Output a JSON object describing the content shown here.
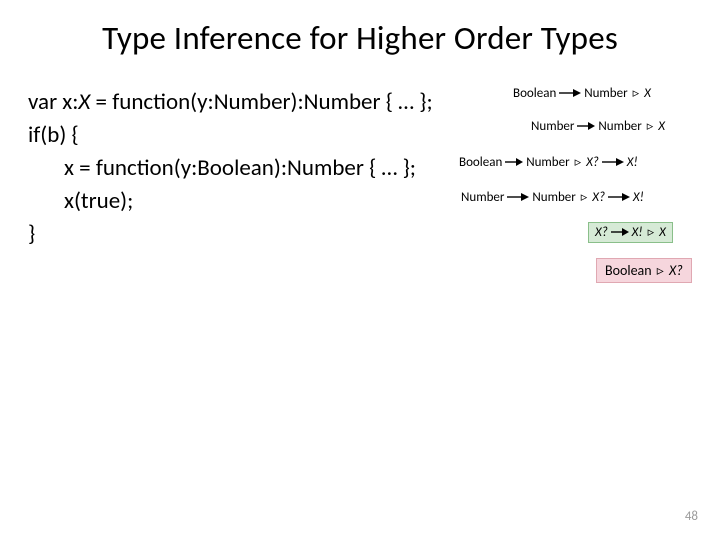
{
  "title": "Type Inference for Higher Order Types",
  "code": {
    "l1_a": "var x:",
    "l1_x": "X",
    "l1_b": " = function(y:Number):Number { … };",
    "l2": "if(b) {",
    "l3": "x = function(y:Boolean):Number { … };",
    "l4": "x(true);",
    "l5": "}"
  },
  "ann": {
    "r1_a": "Boolean",
    "r1_b": "Number ",
    "r1_c": " X",
    "r2_a": "Number",
    "r2_b": "Number ",
    "r2_c": " X",
    "r3_a": "Boolean",
    "r3_b": "Number ",
    "r3_c": " X? ",
    "r3_d": " X!",
    "r4_a": "Number",
    "r4_b": "Number ",
    "r4_c": " X? ",
    "r4_d": " X!",
    "r5_a": "X? ",
    "r5_b": " X! ",
    "r5_c": " X",
    "r6_a": "Boolean ",
    "r6_b": " X?",
    "tri": "▹"
  },
  "pagenum": "48"
}
